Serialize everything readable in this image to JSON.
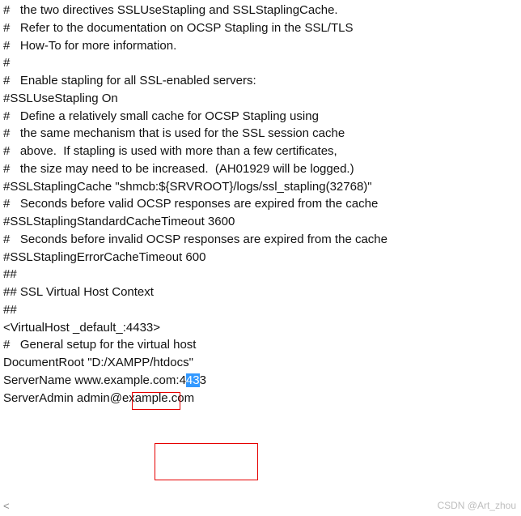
{
  "lines": {
    "l1": "#   the two directives SSLUseStapling and SSLStaplingCache.",
    "l2": "#   Refer to the documentation on OCSP Stapling in the SSL/TLS",
    "l3": "#   How-To for more information.",
    "l4": "#",
    "l5": "#   Enable stapling for all SSL-enabled servers:",
    "l6": "#SSLUseStapling On",
    "l7": "",
    "l8": "#   Define a relatively small cache for OCSP Stapling using",
    "l9": "#   the same mechanism that is used for the SSL session cache",
    "l10": "#   above.  If stapling is used with more than a few certificates,",
    "l11": "#   the size may need to be increased.  (AH01929 will be logged.)",
    "l12": "#SSLStaplingCache \"shmcb:${SRVROOT}/logs/ssl_stapling(32768)\"",
    "l13": "",
    "l14": "#   Seconds before valid OCSP responses are expired from the cache",
    "l15": "#SSLStaplingStandardCacheTimeout 3600",
    "l16": "",
    "l17": "#   Seconds before invalid OCSP responses are expired from the cache",
    "l18": "#SSLStaplingErrorCacheTimeout 600",
    "l19": "",
    "l20": "##",
    "l21": "## SSL Virtual Host Context",
    "l22": "##",
    "l23": "",
    "l24": "<VirtualHost _default_:4433>",
    "l25": "",
    "l26": "#   General setup for the virtual host",
    "l27": "DocumentRoot \"D:/XAMPP/htdocs\"",
    "l28_pre": "ServerName www.example.com:4",
    "l28_sel": "43",
    "l28_post": "3",
    "l29": "ServerAdmin admin@example.com"
  },
  "watermark": "CSDN @Art_zhou",
  "scroll_hint": "<"
}
